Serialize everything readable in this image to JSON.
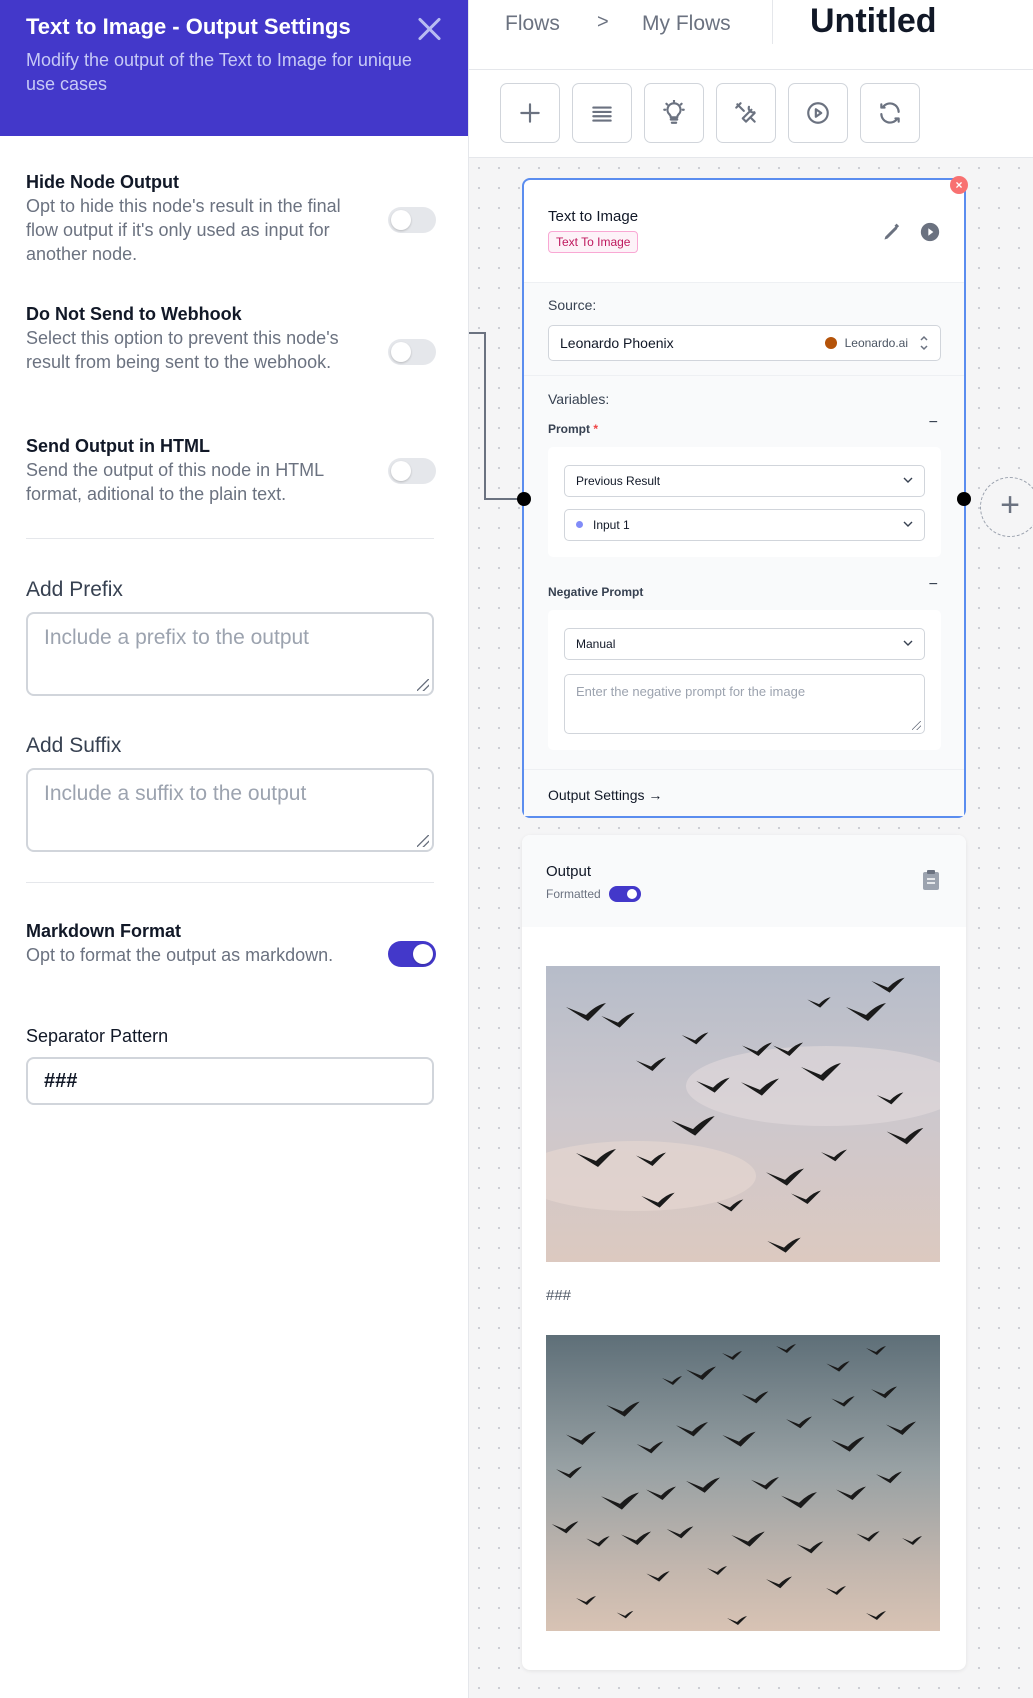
{
  "settings_panel": {
    "title": "Text to Image - Output Settings",
    "subtitle": "Modify the output of the Text to Image for unique use cases",
    "accent_color": "#4338ca",
    "options": [
      {
        "title": "Hide Node Output",
        "description": "Opt to hide this node's result in the final flow output if it's only used as input for another node.",
        "enabled": false
      },
      {
        "title": "Do Not Send to Webhook",
        "description": "Select this option to prevent this node's result from being sent to the webhook.",
        "enabled": false
      },
      {
        "title": "Send Output in HTML",
        "description": "Send the output of this node in HTML format, aditional to the plain text.",
        "enabled": false
      }
    ],
    "prefix": {
      "label": "Add Prefix",
      "placeholder": "Include a prefix to the output",
      "value": ""
    },
    "suffix": {
      "label": "Add Suffix",
      "placeholder": "Include a suffix to the output",
      "value": ""
    },
    "markdown": {
      "title": "Markdown Format",
      "description": "Opt to format the output as markdown.",
      "enabled": true
    },
    "separator": {
      "label": "Separator Pattern",
      "value": "###"
    }
  },
  "topbar": {
    "breadcrumb": [
      "Flows",
      "My Flows"
    ],
    "breadcrumb_separator": ">",
    "flow_title": "Untitled"
  },
  "toolbar": {
    "buttons": [
      "plus-icon",
      "list-icon",
      "lightbulb-icon",
      "tools-icon",
      "play-circle-icon",
      "refresh-icon"
    ]
  },
  "node": {
    "title": "Text to Image",
    "badge": "Text To Image",
    "close_label": "×",
    "source_label": "Source:",
    "source_value": "Leonardo Phoenix",
    "source_provider": "Leonardo.ai",
    "variables_label": "Variables:",
    "prompt_label": "Prompt",
    "prompt_required_mark": "*",
    "prompt_mode": "Previous Result",
    "prompt_input": "Input 1",
    "negative_label": "Negative Prompt",
    "negative_mode": "Manual",
    "negative_placeholder": "Enter the negative prompt for the image",
    "output_settings_link": "Output Settings →",
    "collapse_symbol": "−"
  },
  "add_node_symbol": "+",
  "output": {
    "title": "Output",
    "formatted_label": "Formatted",
    "formatted_enabled": true,
    "separator_text": "###",
    "images": [
      "flock of birds against cloudy sky",
      "flock of birds against dusk sky"
    ]
  }
}
